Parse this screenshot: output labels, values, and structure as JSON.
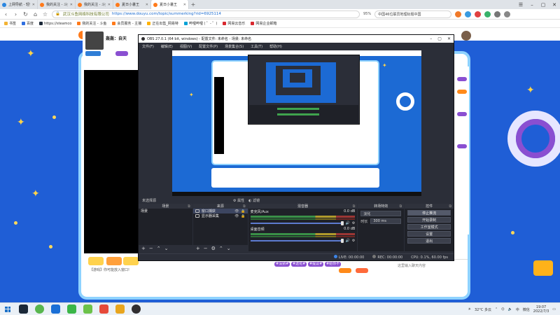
{
  "browser": {
    "tabs": [
      {
        "label": "上网导航 - 轻快上网 从这里开始",
        "color": "#2a86e0",
        "active": false
      },
      {
        "label": "我的关注 - 斗鱼",
        "color": "#ff7a1a",
        "active": false
      },
      {
        "label": "我的关注 - 斗鱼",
        "color": "#ff7a1a",
        "active": false
      },
      {
        "label": "夏日小暑王",
        "color": "#ff7a1a",
        "active": false
      },
      {
        "label": "夏日小暑王",
        "color": "#ff7a1a",
        "active": true
      }
    ],
    "url_site": "武汉斗鱼网络科技有限公司",
    "url_path": "https://www.douyu.com/topic/summerking?rid=6925114",
    "zoom": "95%",
    "search_text": "中国46位联员地理标题中国",
    "bookmarks": [
      "书签",
      "百度",
      "https://steamco",
      "我的关注 - 斗鱼",
      "会员服务 - 主播",
      "正在出售_网易特",
      "哔哩哔哩 ( ゜- ゜)",
      "网易云音乐",
      "网易企业邮箱"
    ]
  },
  "douyu": {
    "home_link": "首页",
    "streamer_name": "轰轰：自天",
    "chat_message": "【游戏】你可能放入窗口!",
    "chat_input": "这里输入聊天内容",
    "hashtags": [
      "#没别#",
      "#送花#",
      "#提议#",
      "#给你不"
    ]
  },
  "obs": {
    "title": "OBS 27.0.1 (64 bit, windows) - 配置文件: 未命名 - 场景: 未命名",
    "menu": [
      "文件(F)",
      "编辑(E)",
      "视图(V)",
      "配置文件(P)",
      "场景集合(S)",
      "工具(T)",
      "帮助(H)"
    ],
    "mode_label": "未选择源",
    "transition_buttons": [
      "属性",
      "滤镜"
    ],
    "docks": {
      "scenes_title": "场景",
      "sources_title": "来源",
      "mixer_title": "混音器",
      "transitions_title": "转场特效",
      "controls_title": "控件"
    },
    "scenes": [
      "场景"
    ],
    "sources": [
      {
        "name": "窗口捕获",
        "icon": "window-icon"
      },
      {
        "name": "显示器采集",
        "icon": "monitor-icon"
      }
    ],
    "mixer": [
      {
        "name": "麦克风/Aux",
        "db": "0.0 dB"
      },
      {
        "name": "桌面音频",
        "db": "0.0 dB"
      }
    ],
    "transition_type": "淡化",
    "duration_label": "时长",
    "duration_value": "300 ms",
    "controls": [
      "停止推流",
      "开始录制",
      "工作室模式",
      "设置",
      "退出"
    ],
    "status": {
      "live": "LIVE: 00:00:00",
      "rec": "REC: 00:00:00",
      "cpu": "CPU: 0.1%, 60.00 fps"
    }
  },
  "taskbar": {
    "temperature": "32°C  多云",
    "ime": "中",
    "app": "微信",
    "time": "19:07",
    "date": "2022/7/3"
  },
  "colors": {
    "page_bg": "#1f5ed6",
    "accent": "#ff7a1a",
    "obs_bg": "#2b2e38"
  }
}
